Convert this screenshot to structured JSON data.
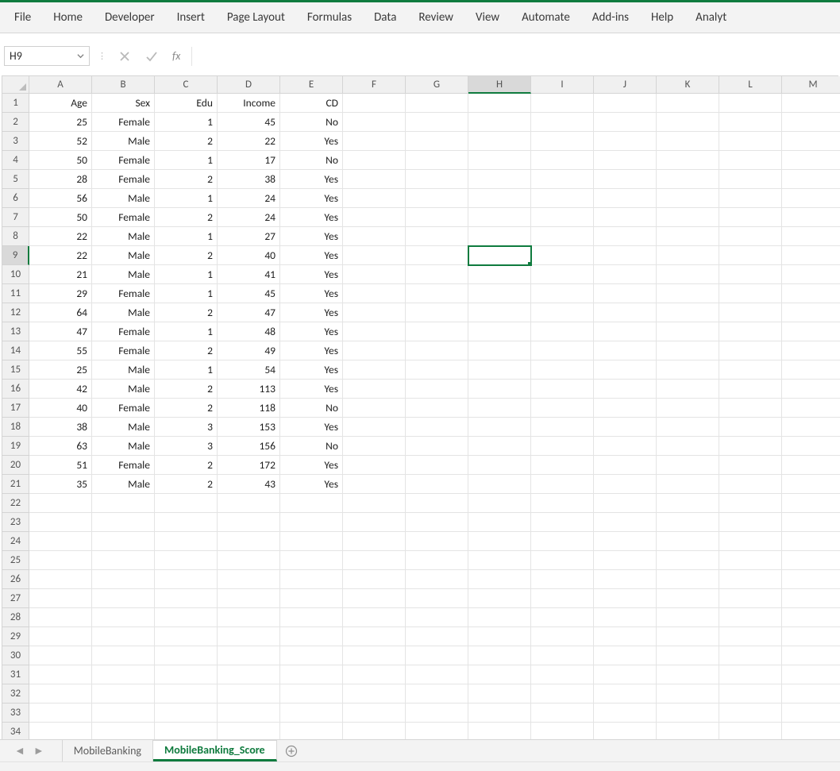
{
  "ribbon": {
    "tabs": [
      "File",
      "Home",
      "Developer",
      "Insert",
      "Page Layout",
      "Formulas",
      "Data",
      "Review",
      "View",
      "Automate",
      "Add-ins",
      "Help",
      "Analyt"
    ]
  },
  "formula_bar": {
    "name_box": "H9",
    "fx_label": "fx",
    "formula": ""
  },
  "grid": {
    "columns": [
      "A",
      "B",
      "C",
      "D",
      "E",
      "F",
      "G",
      "H",
      "I",
      "J",
      "K",
      "L",
      "M"
    ],
    "row_count": 34,
    "active_cell": {
      "col": "H",
      "row": 9
    },
    "headers": [
      "Age",
      "Sex",
      "Edu",
      "Income",
      "CD"
    ],
    "rows": [
      {
        "Age": "25",
        "Sex": "Female",
        "Edu": "1",
        "Income": "45",
        "CD": "No"
      },
      {
        "Age": "52",
        "Sex": "Male",
        "Edu": "2",
        "Income": "22",
        "CD": "Yes"
      },
      {
        "Age": "50",
        "Sex": "Female",
        "Edu": "1",
        "Income": "17",
        "CD": "No"
      },
      {
        "Age": "28",
        "Sex": "Female",
        "Edu": "2",
        "Income": "38",
        "CD": "Yes"
      },
      {
        "Age": "56",
        "Sex": "Male",
        "Edu": "1",
        "Income": "24",
        "CD": "Yes"
      },
      {
        "Age": "50",
        "Sex": "Female",
        "Edu": "2",
        "Income": "24",
        "CD": "Yes"
      },
      {
        "Age": "22",
        "Sex": "Male",
        "Edu": "1",
        "Income": "27",
        "CD": "Yes"
      },
      {
        "Age": "22",
        "Sex": "Male",
        "Edu": "2",
        "Income": "40",
        "CD": "Yes"
      },
      {
        "Age": "21",
        "Sex": "Male",
        "Edu": "1",
        "Income": "41",
        "CD": "Yes"
      },
      {
        "Age": "29",
        "Sex": "Female",
        "Edu": "1",
        "Income": "45",
        "CD": "Yes"
      },
      {
        "Age": "64",
        "Sex": "Male",
        "Edu": "2",
        "Income": "47",
        "CD": "Yes"
      },
      {
        "Age": "47",
        "Sex": "Female",
        "Edu": "1",
        "Income": "48",
        "CD": "Yes"
      },
      {
        "Age": "55",
        "Sex": "Female",
        "Edu": "2",
        "Income": "49",
        "CD": "Yes"
      },
      {
        "Age": "25",
        "Sex": "Male",
        "Edu": "1",
        "Income": "54",
        "CD": "Yes"
      },
      {
        "Age": "42",
        "Sex": "Male",
        "Edu": "2",
        "Income": "113",
        "CD": "Yes"
      },
      {
        "Age": "40",
        "Sex": "Female",
        "Edu": "2",
        "Income": "118",
        "CD": "No"
      },
      {
        "Age": "38",
        "Sex": "Male",
        "Edu": "3",
        "Income": "153",
        "CD": "Yes"
      },
      {
        "Age": "63",
        "Sex": "Male",
        "Edu": "3",
        "Income": "156",
        "CD": "No"
      },
      {
        "Age": "51",
        "Sex": "Female",
        "Edu": "2",
        "Income": "172",
        "CD": "Yes"
      },
      {
        "Age": "35",
        "Sex": "Male",
        "Edu": "2",
        "Income": "43",
        "CD": "Yes"
      }
    ]
  },
  "sheet_tabs": {
    "tabs": [
      "MobileBanking",
      "MobileBanking_Score"
    ],
    "active_index": 1
  }
}
